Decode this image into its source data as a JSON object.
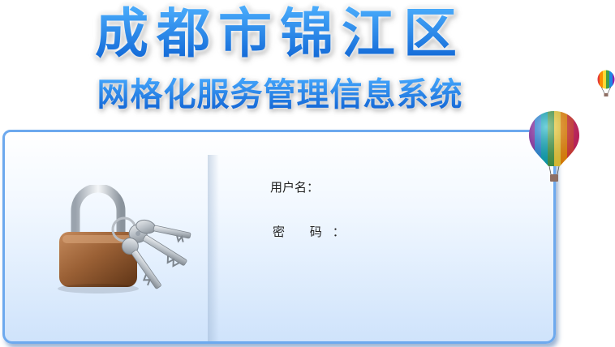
{
  "header": {
    "title": "成都市锦江区",
    "subtitle": "网格化服务管理信息系统"
  },
  "login": {
    "username_label": "用户名：",
    "password_label": "密 码：",
    "username_value": "",
    "password_value": ""
  },
  "icons": {
    "lock": "padlock-with-keys-icon",
    "balloon": "hot-air-balloon-icon"
  },
  "colors": {
    "title_blue": "#1a7ae6",
    "panel_border": "#6da9ee",
    "panel_gradient_end": "#cfe3fb"
  }
}
